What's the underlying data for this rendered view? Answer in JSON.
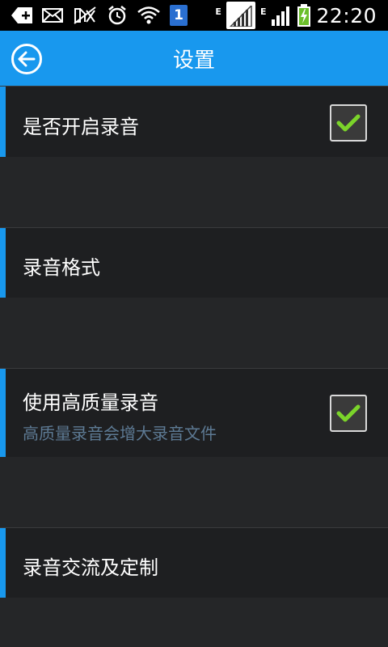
{
  "status_bar": {
    "time": "22:20",
    "sim_slot": "1",
    "network_type_1": "E",
    "network_type_2": "E",
    "icons": [
      "add-icon",
      "mail-icon",
      "mute-icon",
      "alarm-icon",
      "wifi-icon",
      "sim-icon",
      "signal-icon",
      "signal-icon",
      "battery-charging-icon"
    ]
  },
  "action_bar": {
    "title": "设置",
    "back_icon": "back-arrow-icon"
  },
  "settings": [
    {
      "title": "是否开启录音",
      "subtitle": "",
      "checkbox": true,
      "checked": true
    },
    {
      "title": "录音格式",
      "subtitle": "",
      "checkbox": false
    },
    {
      "title": "使用高质量录音",
      "subtitle": "高质量录音会增大录音文件",
      "checkbox": true,
      "checked": true
    },
    {
      "title": "录音交流及定制",
      "subtitle": "",
      "checkbox": false
    }
  ],
  "colors": {
    "accent": "#1898ee",
    "check": "#7bd42a",
    "subtitle": "#5d7a94",
    "row_bg": "#1e1f21",
    "page_bg": "#252628"
  }
}
